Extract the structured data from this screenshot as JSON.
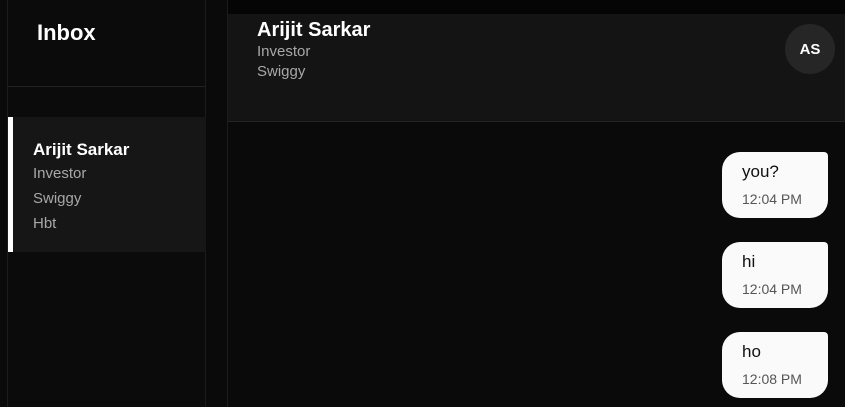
{
  "sidebar": {
    "title": "Inbox",
    "conversations": [
      {
        "name": "Arijit Sarkar",
        "lines": [
          "Investor",
          "Swiggy",
          "Hbt"
        ]
      }
    ]
  },
  "chat": {
    "header": {
      "name": "Arijit Sarkar",
      "role": "Investor",
      "company": "Swiggy",
      "avatar_initials": "AS"
    },
    "messages": [
      {
        "text": "you?",
        "time": "12:04 PM"
      },
      {
        "text": "hi",
        "time": "12:04 PM"
      },
      {
        "text": "ho",
        "time": "12:08 PM"
      }
    ]
  }
}
